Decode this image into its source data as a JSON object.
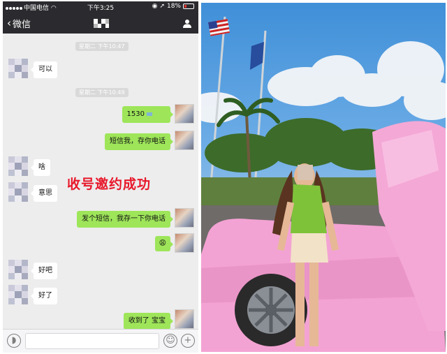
{
  "status_bar": {
    "carrier": "中国电信",
    "time": "下午3:25",
    "battery": "18%"
  },
  "nav": {
    "back_label": "微信"
  },
  "icons": {
    "back": "chevron-left-icon",
    "profile": "person-icon",
    "voice": "voice-icon",
    "emoji": "emoji-icon",
    "plus": "plus-icon"
  },
  "chat": {
    "timestamps": [
      "星期二 下午10:47",
      "星期二 下午10:49"
    ],
    "messages": [
      {
        "dir": "in",
        "text": "可以"
      },
      {
        "dir": "out",
        "text": "1530"
      },
      {
        "dir": "out",
        "text": "短信我，存你电话"
      },
      {
        "dir": "in",
        "text": "啥"
      },
      {
        "dir": "in",
        "text": "意思"
      },
      {
        "dir": "out",
        "text": "发个短信，我存一下你电话"
      },
      {
        "dir": "out",
        "text": "😩"
      },
      {
        "dir": "in",
        "text": "好吧"
      },
      {
        "dir": "in",
        "text": "好了"
      },
      {
        "dir": "out",
        "text": "收到了 宝宝"
      }
    ],
    "overlay_caption": "收号邀约成功"
  },
  "colors": {
    "outgoing_bubble": "#9ee55a",
    "incoming_bubble": "#ffffff",
    "chat_background": "#ededed",
    "header": "#2b2b2f",
    "caption": "#e8182b",
    "car": "#f3a3d3"
  }
}
